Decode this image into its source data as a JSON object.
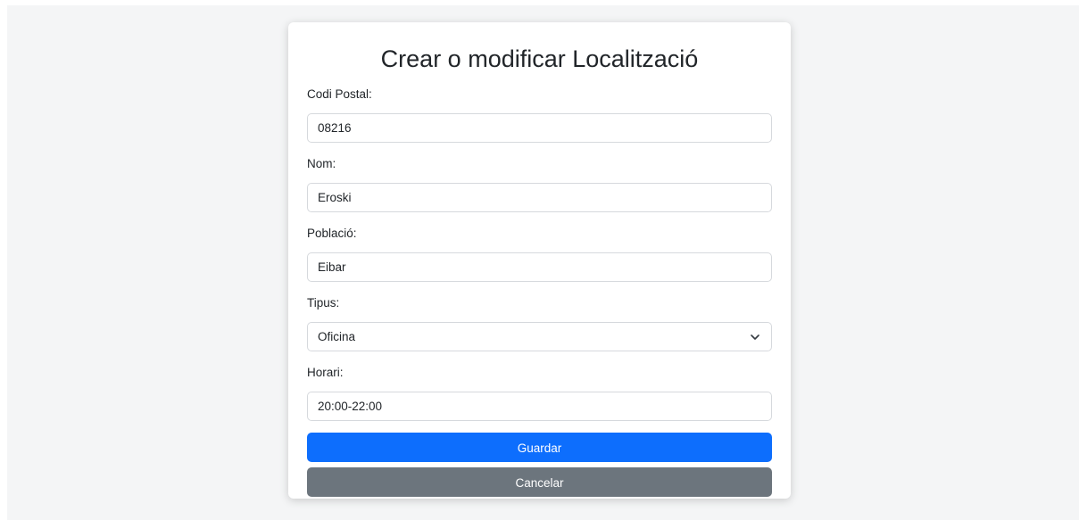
{
  "form": {
    "title": "Crear o modificar Localització",
    "fields": {
      "codi_postal": {
        "label": "Codi Postal:",
        "value": "08216"
      },
      "nom": {
        "label": "Nom:",
        "value": "Eroski"
      },
      "poblacio": {
        "label": "Població:",
        "value": "Eibar"
      },
      "tipus": {
        "label": "Tipus:",
        "value": "Oficina"
      },
      "horari": {
        "label": "Horari:",
        "value": "20:00-22:00"
      }
    },
    "buttons": {
      "save": "Guardar",
      "cancel": "Cancelar"
    }
  },
  "colors": {
    "primary": "#0d6efd",
    "secondary": "#6c757d",
    "background": "#f4f5f6"
  },
  "icons": {
    "select_chevron": "chevron-down-icon"
  }
}
